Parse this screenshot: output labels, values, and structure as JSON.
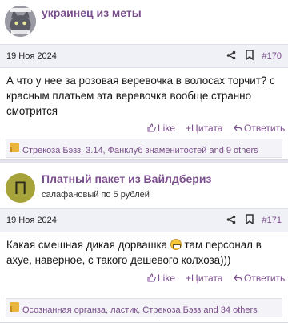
{
  "posts": [
    {
      "author": "украинец из меты",
      "date": "19 Ноя 2024",
      "number": "#170",
      "text": "А что у нее за розовая веревочка в волосах торчит? с красным платьем эта веревочка вообще странно смотрится",
      "actions": {
        "like": "Like",
        "quote": "Цитата",
        "reply": "Ответить"
      },
      "reactions": "Стрекоза Бэзз, 3.14, Фанклуб знаменитостей and 9 others"
    },
    {
      "author": "Платный пакет из Вайлдбериз",
      "avatar_letter": "П",
      "user_title": "салафановый по 5 рублей",
      "date": "19 Ноя 2024",
      "number": "#171",
      "text_before": "Какая смешная дикая дорвашка",
      "text_after": "там персонал в ахуе, наверное, с такого дешевого колхоза)))",
      "actions": {
        "like": "Like",
        "quote": "Цитата",
        "reply": "Ответить"
      },
      "reactions": "Осознанная органза, ластик, Стрекоза Бэзз and 34 others"
    }
  ],
  "colors": {
    "accent": "#7a4d8c",
    "meta_bg": "#f0f0f7",
    "avatar_green": "#a6a33a"
  },
  "icons": [
    "share-icon",
    "bookmark-icon",
    "like-icon",
    "quote-icon",
    "reply-icon",
    "reaction-thumb-icon",
    "grin-emoji"
  ]
}
